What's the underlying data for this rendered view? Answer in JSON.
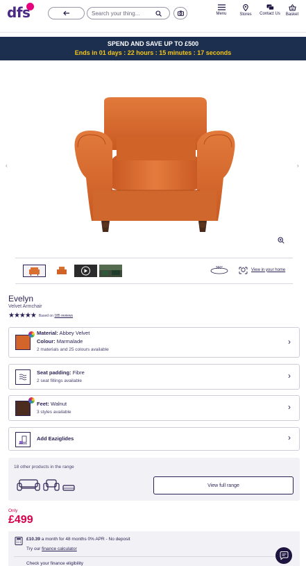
{
  "header": {
    "logo_text": "dfs",
    "search_placeholder": "Search your thing...",
    "nav": [
      {
        "label": "Menu",
        "icon": "hamburger-icon"
      },
      {
        "label": "Stores",
        "icon": "location-pin-icon"
      },
      {
        "label": "Contact Us",
        "icon": "chat-icon"
      },
      {
        "label": "Basket",
        "icon": "basket-icon"
      }
    ]
  },
  "promo": {
    "title": "SPEND AND SAVE UP TO £500",
    "countdown": "Ends in  01 days : 22 hours :  15  minutes :  17  seconds"
  },
  "media": {
    "view_360_label": "360°",
    "view_in_home_label": "View in your home"
  },
  "product": {
    "name": "Evelyn",
    "type": "Velvet Armchair",
    "stars": "★★★★★",
    "rating_value": 4.5,
    "reviews_prefix": "Based on",
    "reviews_link": "185 reviews"
  },
  "options": {
    "material": {
      "label": "Material:",
      "value": "Abbey Velvet",
      "colour_label": "Colour:",
      "colour_value": "Marmalade",
      "sub": "2 materials and 25 colours available",
      "swatch_color": "#d4652a"
    },
    "seat": {
      "label": "Seat padding:",
      "value": "Fibre",
      "sub": "2 seat fillings available"
    },
    "feet": {
      "label": "Feet:",
      "value": "Walnut",
      "sub": "3 styles available",
      "swatch_color": "#4b2c1e"
    },
    "eaziglides": {
      "label": "Add Eaziglides"
    }
  },
  "range": {
    "label": "18 other products in the range",
    "button": "View full range"
  },
  "price": {
    "only": "Only",
    "value": "£499"
  },
  "finance": {
    "line1_bold": "£10.39",
    "line1_rest": "a month for 48 months 0% APR - No deposit",
    "line2_prefix": "Try our",
    "line2_link": "finance calculator",
    "line3": "Check your finance eligibility"
  },
  "colors": {
    "brand": "#4b2a86",
    "promo_bg": "#1c2f4e",
    "promo_accent": "#f5c518",
    "price": "#d6004c"
  }
}
